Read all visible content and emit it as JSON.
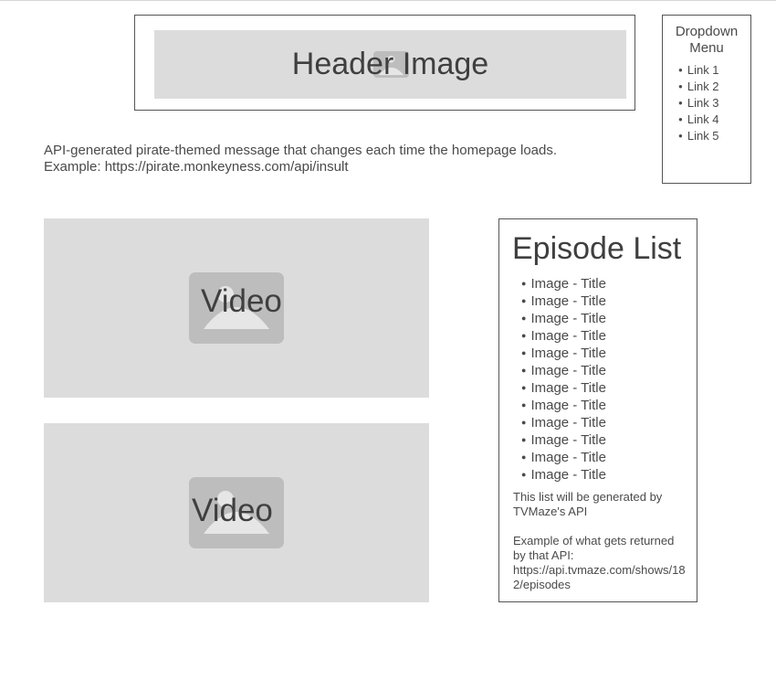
{
  "header": {
    "image_label": "Header Image",
    "icon": "image-placeholder-icon"
  },
  "dropdown": {
    "title": "Dropdown Menu",
    "links": [
      "Link 1",
      "Link 2",
      "Link 3",
      "Link 4",
      "Link 5"
    ]
  },
  "pirate_message": {
    "line1": "API-generated pirate-themed message that changes each time the homepage loads.",
    "line2": "Example:  https://pirate.monkeyness.com/api/insult"
  },
  "videos": [
    {
      "label": "Video",
      "icon": "image-placeholder-icon"
    },
    {
      "label": "Video",
      "icon": "image-placeholder-icon"
    }
  ],
  "episode_list": {
    "title": "Episode List",
    "items": [
      "Image - Title",
      "Image - Title",
      "Image - Title",
      "Image - Title",
      "Image - Title",
      "Image - Title",
      "Image - Title",
      "Image - Title",
      "Image - Title",
      "Image - Title",
      "Image - Title",
      "Image - Title"
    ],
    "note1": "This list will be generated by TVMaze's  API",
    "note2_line1": "Example of what gets returned by that API:",
    "note2_line2": "https://api.tvmaze.com/shows/182/episodes"
  },
  "colors": {
    "placeholder_bg": "#dcdcdc",
    "placeholder_icon": "#bdbdbd",
    "border": "#555555",
    "text": "#4a4a4a"
  }
}
